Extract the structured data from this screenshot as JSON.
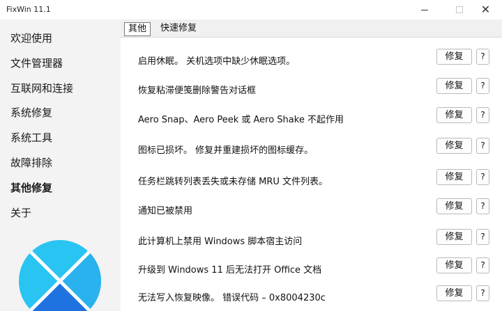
{
  "window": {
    "title": "FixWin 11.1"
  },
  "sidebar": {
    "items": [
      {
        "label": "欢迎使用"
      },
      {
        "label": "文件管理器"
      },
      {
        "label": "互联网和连接"
      },
      {
        "label": "系统修复"
      },
      {
        "label": "系统工具"
      },
      {
        "label": "故障排除"
      },
      {
        "label": "其他修复",
        "active": true
      },
      {
        "label": "关于"
      }
    ]
  },
  "tabs": [
    {
      "label": "其他",
      "active": true
    },
    {
      "label": "快速修复",
      "active": false
    }
  ],
  "fixes": [
    {
      "label": "启用休眠。 关机选项中缺少休眠选项。"
    },
    {
      "label": "恢复粘滞便笺删除警告对话框"
    },
    {
      "label": "Aero Snap、Aero Peek 或 Aero Shake 不起作用"
    },
    {
      "label": "图标已损坏。 修复并重建损坏的图标缓存。"
    },
    {
      "label": "任务栏跳转列表丢失或未存储 MRU 文件列表。"
    },
    {
      "label": "通知已被禁用"
    },
    {
      "label": "此计算机上禁用 Windows 脚本宿主访问"
    },
    {
      "label": "升级到 Windows 11 后无法打开 Office 文档"
    },
    {
      "label": "无法写入恢复映像。 错误代码 – 0x8004230c"
    }
  ],
  "buttons": {
    "fix_label": "修复",
    "help_label": "?"
  },
  "icons": {
    "minimize": "minimize-icon",
    "maximize": "maximize-icon",
    "close": "close-icon",
    "logo": "fixwin-logo"
  },
  "colors": {
    "sidebar_bg": "#f3f3f3",
    "logo_light": "#29c4f2",
    "logo_dark": "#1f73e0"
  }
}
